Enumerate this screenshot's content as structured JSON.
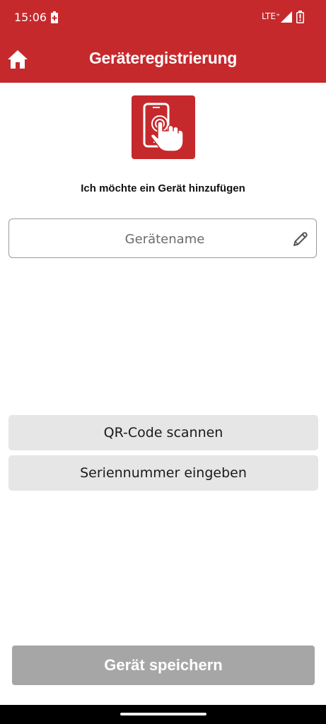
{
  "status_bar": {
    "time": "15:06",
    "network": "LTE⁺",
    "battery_saver_icon": "battery-saver-icon",
    "signal_icon": "signal-icon",
    "battery_icon": "battery-low-icon"
  },
  "app_bar": {
    "title": "Geräteregistrierung",
    "home_icon": "home-icon",
    "background_color": "#c6292c"
  },
  "hero": {
    "icon": "touch-phone-icon",
    "intro_text": "Ich möchte ein Gerät hinzufügen"
  },
  "device_name_field": {
    "placeholder": "Gerätename",
    "value": "",
    "edit_icon": "pencil-icon"
  },
  "options": {
    "qr_code_label": "QR-Code scannen",
    "serial_number_label": "Seriennummer eingeben"
  },
  "footer": {
    "save_label": "Gerät speichern",
    "save_disabled": true
  },
  "colors": {
    "accent": "#c6292c",
    "option_button": "#e6e6e6",
    "disabled_button": "#a6a6a6"
  }
}
